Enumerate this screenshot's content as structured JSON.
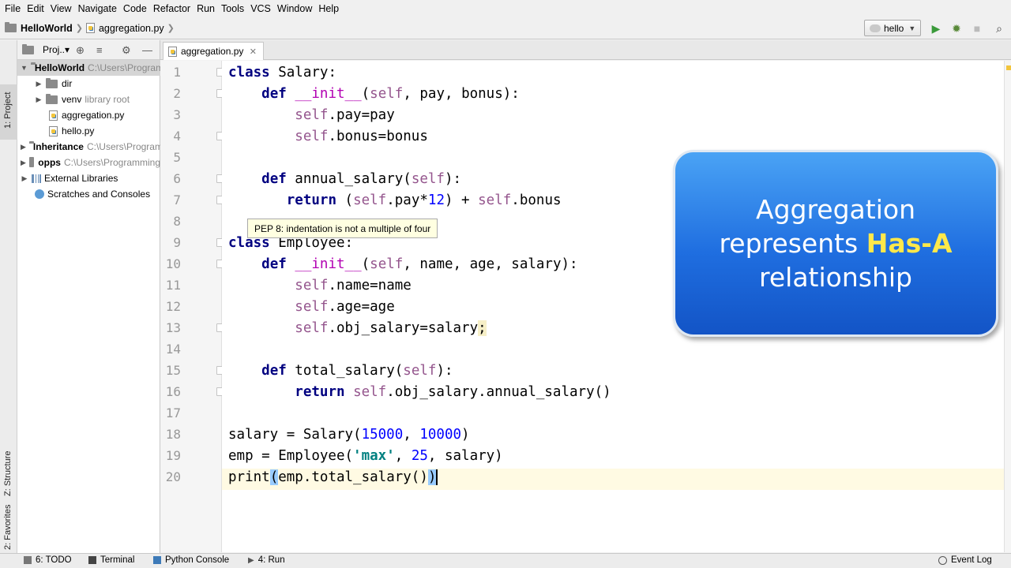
{
  "menu": [
    "File",
    "Edit",
    "View",
    "Navigate",
    "Code",
    "Refactor",
    "Run",
    "Tools",
    "VCS",
    "Window",
    "Help"
  ],
  "breadcrumb": {
    "project": "HelloWorld",
    "file": "aggregation.py"
  },
  "run_config": {
    "name": "hello"
  },
  "left_strip": {
    "project_tab": "1: Project",
    "structure_tab": "Z: Structure",
    "favorites_tab": "2: Favorites"
  },
  "project_panel": {
    "title": "Proj..▾",
    "tree": [
      {
        "label": "HelloWorld",
        "path": "C:\\Users\\Programming",
        "bold": true
      },
      {
        "label": "dir"
      },
      {
        "label": "venv",
        "suffix": "library root"
      },
      {
        "label": "aggregation.py"
      },
      {
        "label": "hello.py"
      },
      {
        "label": "Inheritance",
        "path": "C:\\Users\\Programming",
        "bold": true
      },
      {
        "label": "opps",
        "path": "C:\\Users\\Programming",
        "bold": true
      },
      {
        "label": "External Libraries"
      },
      {
        "label": "Scratches and Consoles"
      }
    ]
  },
  "editor": {
    "tab": "aggregation.py",
    "line_numbers": [
      "1",
      "2",
      "3",
      "4",
      "5",
      "6",
      "7",
      "8",
      "9",
      "10",
      "11",
      "12",
      "13",
      "14",
      "15",
      "16",
      "17",
      "18",
      "19",
      "20"
    ],
    "tooltip": "PEP 8: indentation is not a multiple of four",
    "code": {
      "l1_kw": "class",
      "l1_rest": " Salary:",
      "l2_kw": "def",
      "l2_fn": "__init__",
      "l2_self": "self",
      "l2_rest": ", pay, bonus):",
      "l3_self": "self",
      "l3_rest": ".pay=pay",
      "l4_self": "self",
      "l4_rest": ".bonus=bonus",
      "l6_kw": "def",
      "l6_a": " annual_salary(",
      "l6_self": "self",
      "l6_b": "):",
      "l7_kw": "return",
      "l7_a": " (",
      "l7_self1": "self",
      "l7_b": ".pay*",
      "l7_num": "12",
      "l7_c": ") + ",
      "l7_self2": "self",
      "l7_d": ".bonus",
      "l9_kw": "class",
      "l9_rest": " Employee:",
      "l10_kw": "def",
      "l10_fn": "__init__",
      "l10_self": "self",
      "l10_rest": ", name, age, salary):",
      "l11_self": "self",
      "l11_rest": ".name=name",
      "l12_self": "self",
      "l12_rest": ".age=age",
      "l13_self": "self",
      "l13_rest": ".obj_salary=salary",
      "l13_semi": ";",
      "l15_kw": "def",
      "l15_a": " total_salary(",
      "l15_self": "self",
      "l15_b": "):",
      "l16_kw": "return",
      "l16_self": "self",
      "l16_rest": ".obj_salary.annual_salary()",
      "l18_a": "salary = Salary(",
      "l18_n1": "15000",
      "l18_b": ", ",
      "l18_n2": "10000",
      "l18_c": ")",
      "l19_a": "emp = Employee(",
      "l19_str": "'max'",
      "l19_b": ", ",
      "l19_num": "25",
      "l19_c": ", salary)",
      "l20_a": "print",
      "l20_b": "(",
      "l20_c": "emp.total_salary()",
      "l20_d": ")"
    }
  },
  "callout": {
    "line1": "Aggregation",
    "line2": "represents",
    "highlight": "Has-A",
    "line3": "relationship"
  },
  "bottom_bar": {
    "todo": "6: TODO",
    "terminal": "Terminal",
    "python_console": "Python Console",
    "run": "4: Run",
    "event_log": "Event Log"
  }
}
